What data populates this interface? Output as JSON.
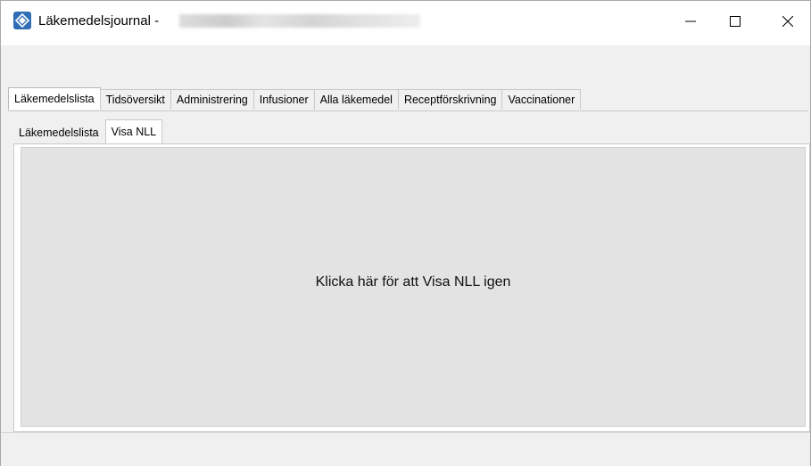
{
  "window": {
    "title": "Läkemedelsjournal -",
    "accent_color": "#2f6db5"
  },
  "icons": {
    "app": "app-logo-icon",
    "minimize": "minimize-icon",
    "maximize": "maximize-icon",
    "close": "close-icon"
  },
  "tabs": [
    {
      "label": "Läkemedelslista",
      "active": true
    },
    {
      "label": "Tidsöversikt",
      "active": false
    },
    {
      "label": "Administrering",
      "active": false
    },
    {
      "label": "Infusioner",
      "active": false
    },
    {
      "label": "Alla läkemedel",
      "active": false
    },
    {
      "label": "Receptförskrivning",
      "active": false
    },
    {
      "label": "Vaccinationer",
      "active": false
    }
  ],
  "subtabs": [
    {
      "label": "Läkemedelslista",
      "active": false
    },
    {
      "label": "Visa NLL",
      "active": true
    }
  ],
  "main": {
    "message": "Klicka här för att Visa NLL igen"
  }
}
